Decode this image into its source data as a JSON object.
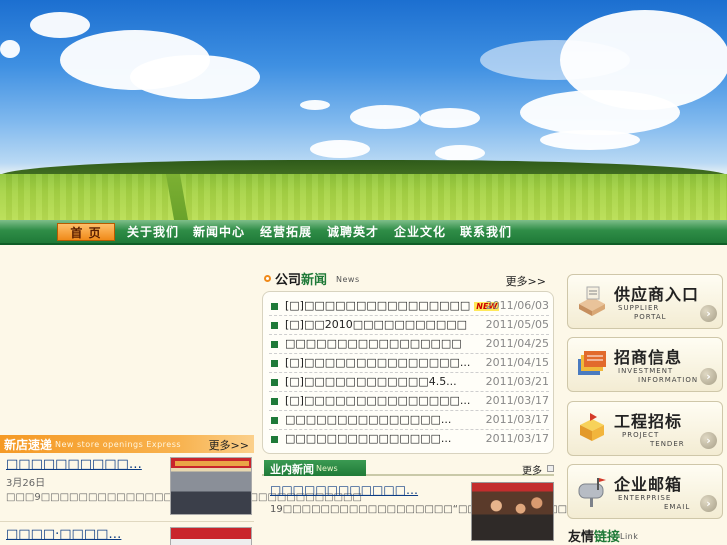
{
  "nav": {
    "items": [
      "首 页",
      "关于我们",
      "新闻中心",
      "经营拓展",
      "诚聘英才",
      "企业文化",
      "联系我们"
    ]
  },
  "store": {
    "title": "新店速递",
    "subtitle": "New store openings Express",
    "more": "更多>>",
    "items": [
      {
        "title": "□□□□□□□□□□…",
        "desc": "3月26日□□□9□□□□□□□□□□□□□□□□□□□□□□□□□□□□□□□□□□"
      },
      {
        "title": "□□□□·□□□□…"
      }
    ]
  },
  "company_news": {
    "title_prefix": "公司",
    "title_suffix": "新闻",
    "subtitle": "News",
    "more": "更多>>",
    "new_badge": "NEW",
    "items": [
      {
        "text": "[□]□□□□□□□□□□□□□□□□",
        "date": "2011/06/03"
      },
      {
        "text": "[□]□□2010□□□□□□□□□□□",
        "date": "2011/05/05"
      },
      {
        "text": "□□□□□□□□□□□□□□□□□",
        "date": "2011/04/25"
      },
      {
        "text": "[□]□□□□□□□□□□□□□□□...",
        "date": "2011/04/15"
      },
      {
        "text": "[□]□□□□□□□□□□□□4.5...",
        "date": "2011/03/21"
      },
      {
        "text": "[□]□□□□□□□□□□□□□□□...",
        "date": "2011/03/17"
      },
      {
        "text": "□□□□□□□□□□□□□□□...",
        "date": "2011/03/17"
      },
      {
        "text": "□□□□□□□□□□□□□□□...",
        "date": "2011/03/17"
      }
    ]
  },
  "industry_news": {
    "title": "业内新闻",
    "subtitle": "News",
    "more": "更多",
    "item_title": "□□□□□□□□□□□□…",
    "item_desc": "19□□□□□□□□□□□□□□□□□□“□□□”□□□□□□□□□□□□□□□□□□□□□□…"
  },
  "portals": [
    {
      "cn": "供应商入口",
      "en1": "SUPPLIER",
      "en2": "PORTAL",
      "icon": "supplier-icon"
    },
    {
      "cn": "招商信息",
      "en1": "INVESTMENT",
      "en2": "INFORMATION",
      "icon": "investment-icon"
    },
    {
      "cn": "工程招标",
      "en1": "PROJECT",
      "en2": "TENDER",
      "icon": "project-icon"
    },
    {
      "cn": "企业邮箱",
      "en1": "ENTERPRISE",
      "en2": "EMAIL",
      "icon": "mailbox-icon"
    }
  ],
  "links": {
    "title_prefix": "友情",
    "title_suffix": "链接",
    "subtitle": "Link"
  },
  "colors": {
    "nav_green": "#1f7a38",
    "accent_orange": "#f08a1a",
    "link_blue": "#0c3c84",
    "page_bg": "#fdf8e8"
  }
}
